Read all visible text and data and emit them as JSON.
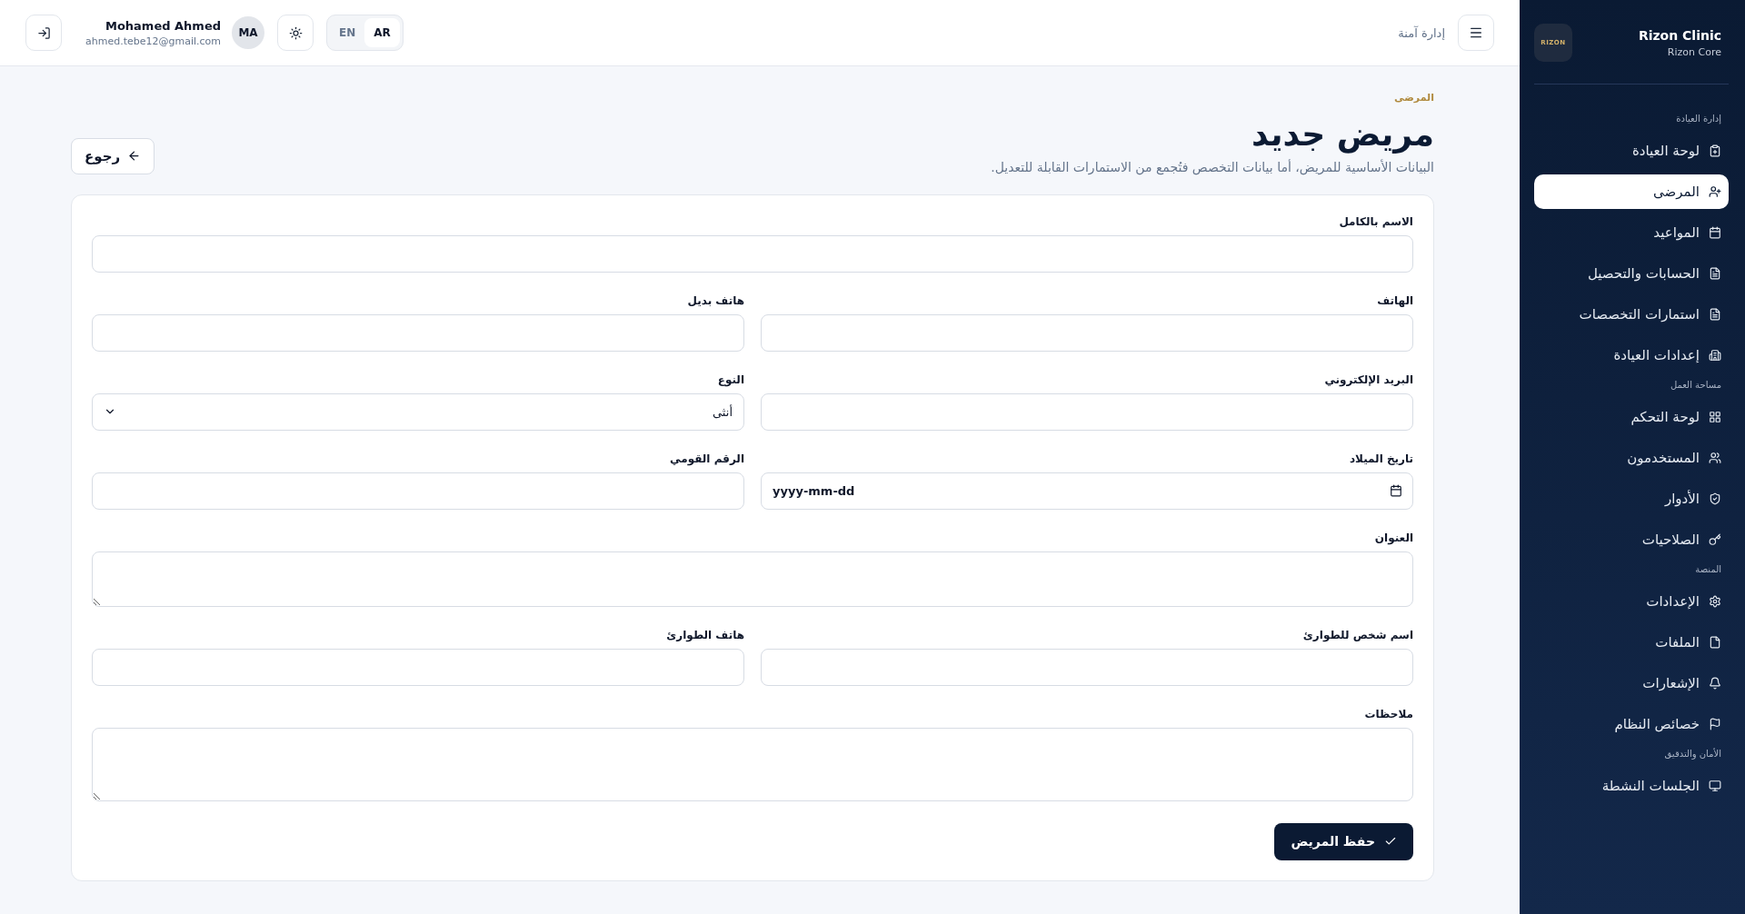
{
  "header": {
    "menu_label": "إدارة آمنة",
    "user": {
      "name": "Mohamed Ahmed",
      "email": "ahmed.tebe12@gmail.com",
      "initials": "MA"
    },
    "languages": [
      {
        "label": "AR",
        "selected": true
      },
      {
        "label": "EN",
        "selected": false
      }
    ]
  },
  "page": {
    "breadcrumb": "المرضى",
    "title": "مريض جديد",
    "subtitle": "البيانات الأساسية للمريض، أما بيانات التخصص فتُجمع من الاستمارات القابلة للتعديل.",
    "back_button": "رجوع"
  },
  "form": {
    "rows": [
      {
        "fields": [
          {
            "label": "الاسم بالكامل",
            "kind": "text"
          }
        ]
      },
      {
        "fields": [
          {
            "label": "الهاتف",
            "kind": "text"
          },
          {
            "label": "هاتف بديل",
            "kind": "text"
          }
        ]
      },
      {
        "fields": [
          {
            "label": "البريد الإلكتروني",
            "kind": "text"
          },
          {
            "label": "النوع",
            "kind": "select",
            "value": "أنثى"
          }
        ]
      },
      {
        "fields": [
          {
            "label": "تاريخ الميلاد",
            "kind": "date",
            "placeholder": "yyyy-mm-dd"
          },
          {
            "label": "الرقم القومي",
            "kind": "text"
          }
        ]
      },
      {
        "fields": [
          {
            "label": "العنوان",
            "kind": "textarea"
          }
        ]
      },
      {
        "fields": [
          {
            "label": "اسم شخص للطوارئ",
            "kind": "text"
          },
          {
            "label": "هاتف الطوارئ",
            "kind": "text"
          }
        ]
      },
      {
        "fields": [
          {
            "label": "ملاحظات",
            "kind": "textarea_tall"
          }
        ]
      }
    ],
    "submit": "حفظ المريض"
  },
  "sidebar": {
    "brand": {
      "name": "Rizon Clinic",
      "subtitle": "Rizon Core",
      "logo_text": "RIZON"
    },
    "sections": [
      {
        "title": "إدارة العيادة",
        "items": [
          {
            "label": "لوحة العيادة",
            "selected": false
          },
          {
            "label": "المرضى",
            "selected": true
          },
          {
            "label": "المواعيد",
            "selected": false
          },
          {
            "label": "الحسابات والتحصيل",
            "selected": false
          },
          {
            "label": "استمارات التخصصات",
            "selected": false
          },
          {
            "label": "إعدادات العيادة",
            "selected": false
          }
        ]
      },
      {
        "title": "مساحة العمل",
        "items": [
          {
            "label": "لوحة التحكم",
            "selected": false
          },
          {
            "label": "المستخدمون",
            "selected": false
          },
          {
            "label": "الأدوار",
            "selected": false
          },
          {
            "label": "الصلاحيات",
            "selected": false
          }
        ]
      },
      {
        "title": "المنصة",
        "items": [
          {
            "label": "الإعدادات",
            "selected": false
          },
          {
            "label": "الملفات",
            "selected": false
          },
          {
            "label": "الإشعارات",
            "selected": false
          },
          {
            "label": "خصائص النظام",
            "selected": false
          }
        ]
      },
      {
        "title": "الأمان والتدقيق",
        "items": [
          {
            "label": "الجلسات النشطة",
            "selected": false
          }
        ]
      }
    ]
  }
}
